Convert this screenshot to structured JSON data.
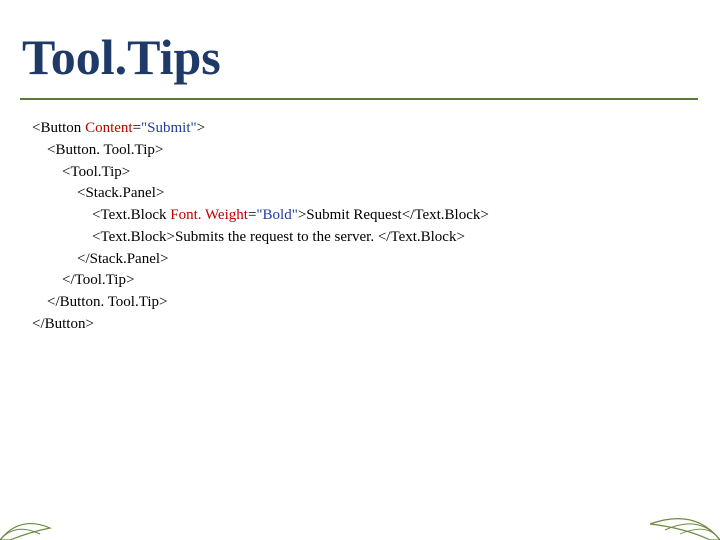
{
  "title": "Tool.Tips",
  "code": {
    "l1_pre": "<Button ",
    "l1_attr": "Content",
    "l1_eq": "=",
    "l1_val": "\"Submit\"",
    "l1_post": ">",
    "l2": "    <Button. Tool.Tip>",
    "l3": "        <Tool.Tip>",
    "l4": "            <Stack.Panel>",
    "l5_pre": "                <Text.Block ",
    "l5_attr": "Font. Weight",
    "l5_eq": "=",
    "l5_val": "\"Bold\"",
    "l5_post": ">Submit Request</Text.Block>",
    "l6": "                <Text.Block>Submits the request to the server. </Text.Block>",
    "l7": "            </Stack.Panel>",
    "l8": "        </Tool.Tip>",
    "l9": "    </Button. Tool.Tip>",
    "l10": "</Button>"
  }
}
